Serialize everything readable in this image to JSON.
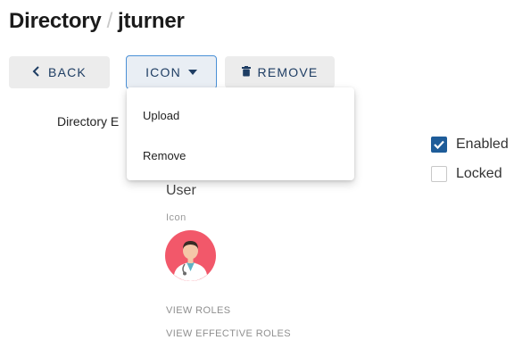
{
  "header": {
    "section": "Directory",
    "username": "jturner"
  },
  "toolbar": {
    "back_label": "BACK",
    "icon_label": "ICON",
    "remove_label": "REMOVE"
  },
  "dropdown": {
    "items": [
      {
        "label": "Upload"
      },
      {
        "label": "Remove"
      }
    ]
  },
  "form": {
    "directory_label_partial": "Directory E",
    "enabled": {
      "label": "Enabled",
      "checked": true
    },
    "locked": {
      "label": "Locked",
      "checked": false
    },
    "user_type": "User",
    "icon_field_label": "Icon"
  },
  "links": {
    "view_roles": "VIEW ROLES",
    "view_effective_roles": "VIEW EFFECTIVE ROLES"
  },
  "colors": {
    "accent": "#1e5c99",
    "button_text": "#1e3d63",
    "avatar_bg": "#f2586a"
  },
  "icons": {
    "back": "chevron-left-icon",
    "dropdown": "caret-down-icon",
    "remove": "trash-icon",
    "avatar": "doctor-avatar-icon"
  }
}
